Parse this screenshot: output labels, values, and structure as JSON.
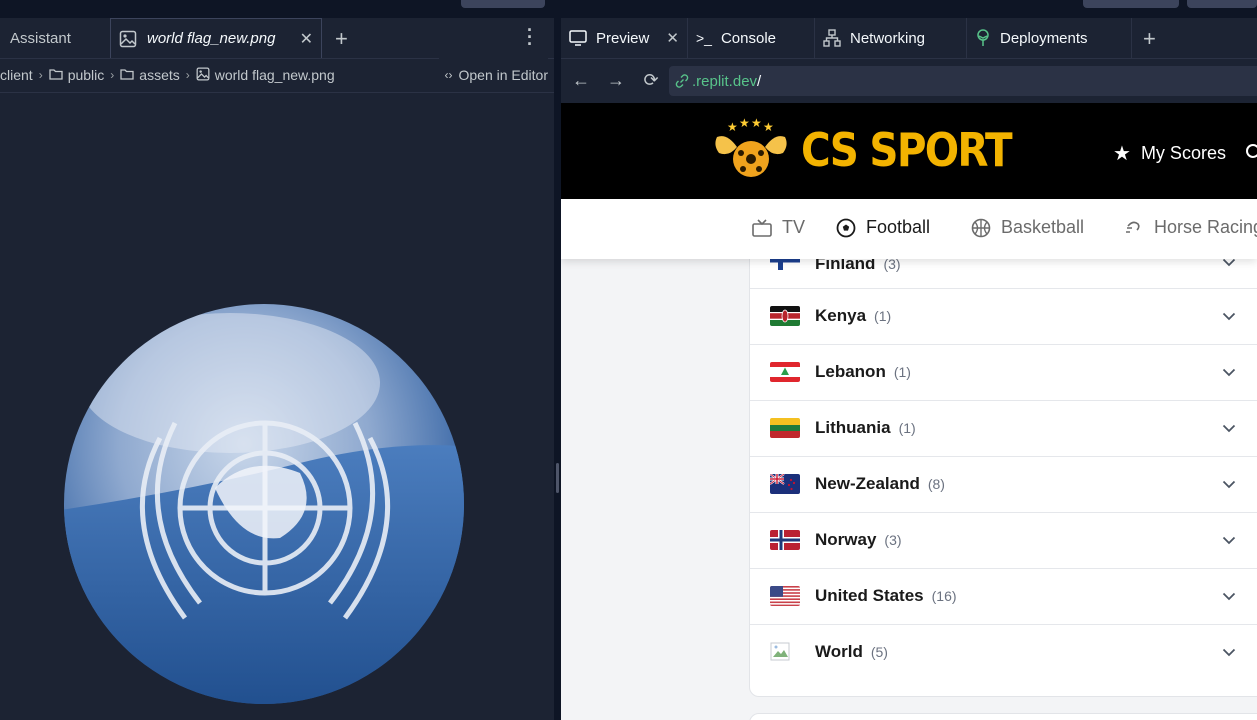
{
  "left_pane": {
    "tabs": [
      {
        "label": "Assistant"
      },
      {
        "label": "world flag_new.png",
        "icon": "image-icon"
      }
    ],
    "breadcrumb": [
      "client",
      "public",
      "assets",
      "world flag_new.png"
    ],
    "open_in_editor": "Open in Editor",
    "image": {
      "description_icon": "un-globe-emblem-image"
    }
  },
  "right_pane": {
    "tabs": [
      {
        "label": "Preview",
        "icon": "monitor-icon"
      },
      {
        "label": "Console",
        "icon": "terminal-icon"
      },
      {
        "label": "Networking",
        "icon": "network-icon"
      },
      {
        "label": "Deployments",
        "icon": "deploy-icon"
      }
    ],
    "url": {
      "host": ".replit.dev",
      "path": "/"
    },
    "site": {
      "brand": "CS SPORT",
      "my_scores": "My Scores",
      "sports": [
        {
          "label": "TV"
        },
        {
          "label": "Football"
        },
        {
          "label": "Basketball"
        },
        {
          "label": "Horse Racing"
        }
      ],
      "countries": [
        {
          "name": "Finland",
          "count": "(3)"
        },
        {
          "name": "Kenya",
          "count": "(1)"
        },
        {
          "name": "Lebanon",
          "count": "(1)"
        },
        {
          "name": "Lithuania",
          "count": "(1)"
        },
        {
          "name": "New-Zealand",
          "count": "(8)"
        },
        {
          "name": "Norway",
          "count": "(3)"
        },
        {
          "name": "United States",
          "count": "(16)"
        },
        {
          "name": "World",
          "count": "(5)"
        }
      ]
    }
  },
  "colors": {
    "brand_gold": "#f3b300",
    "ide_bg": "#1c2333",
    "url_green": "#58c38a"
  }
}
